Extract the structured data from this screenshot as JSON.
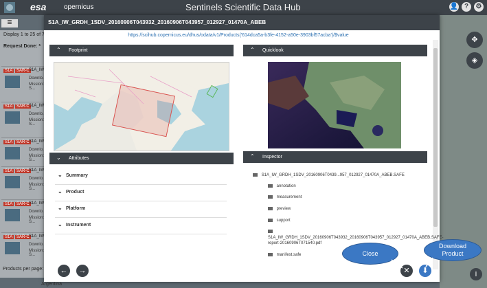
{
  "app": {
    "title": "Sentinels Scientific Data Hub",
    "esa_logo": "esa",
    "copernicus_logo": "opernicus",
    "icons": [
      "user-icon",
      "help-icon",
      "settings-icon"
    ]
  },
  "background_list": {
    "display_text": "Display 1 to 25 of 7...",
    "request_text": "Request Done: *",
    "menu_label": "☰",
    "items": [
      {
        "tag": "S1A",
        "tag2": "SAR-C",
        "title": "S1A_IW",
        "line1": "Downlo...",
        "line2": "Mission: S..."
      },
      {
        "tag": "S1A",
        "tag2": "SAR-C",
        "title": "S1A_IW",
        "line1": "Downlo...",
        "line2": "Mission: S..."
      },
      {
        "tag": "S1A",
        "tag2": "SAR-C",
        "title": "S1A_IW",
        "line1": "Downlo...",
        "line2": "Mission: S..."
      },
      {
        "tag": "S1A",
        "tag2": "SAR-C",
        "title": "S1A_IW",
        "line1": "Downlo...",
        "line2": "Mission: S..."
      },
      {
        "tag": "S1A",
        "tag2": "SAR-C",
        "title": "S1A_IW",
        "line1": "Downlo...",
        "line2": "Mission: S..."
      },
      {
        "tag": "S1A",
        "tag2": "SAR-C",
        "title": "S1A_IW",
        "line1": "Downlo...",
        "line2": "Mission: S..."
      }
    ],
    "bottom_text": "Products per page: 25",
    "argentina": "Argentina"
  },
  "modal": {
    "title": "S1A_IW_GRDH_1SDV_20160906T043932_20160906T043957_012927_01470A_ABEB",
    "url": "https://scihub.copernicus.eu/dhus/odata/v1/Products('614dca5a-b3fe-4152-a50e-3903bf57acba')/$value",
    "footprint_label": "Footprint",
    "quicklook_label": "Quicklook",
    "attributes_label": "Attributes",
    "inspector_label": "Inspector",
    "attributes": [
      "Summary",
      "Product",
      "Platform",
      "Instrument"
    ],
    "inspector_root": "S1A_IW_GRDH_1SDV_20160906T0439...957_012927_01470A_ABEB.SAFE",
    "inspector_items": [
      "annotation",
      "measurement",
      "preview",
      "support",
      "S1A_IW_GRDH_1SDV_20160906T043932_20160906T043957_012927_01470A_ABEB.SAFE-",
      "report-20160906T071540.pdf",
      "manifest.safe"
    ]
  },
  "callouts": {
    "close": "Close",
    "download": "Download Product"
  },
  "colors": {
    "header": "#3d4349",
    "accent": "#3b78c4",
    "footprint": "#d9534f"
  }
}
